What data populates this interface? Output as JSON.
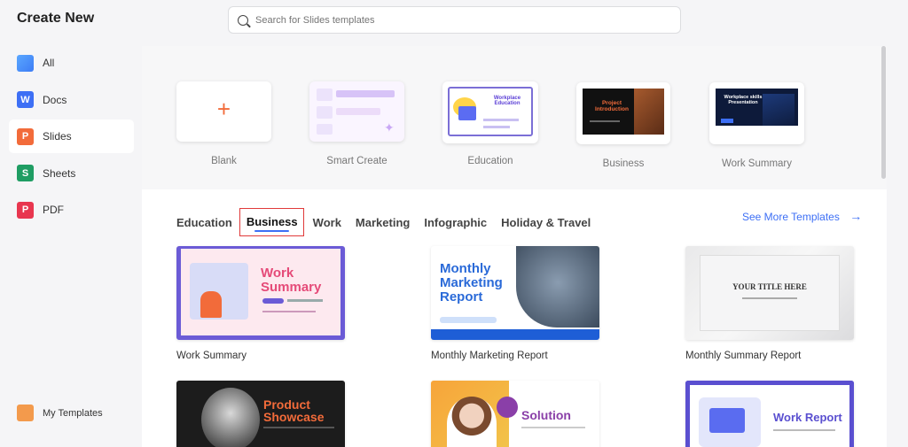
{
  "app": {
    "title": "Create New"
  },
  "search": {
    "placeholder": "Search for Slides templates"
  },
  "sidebar": {
    "items": [
      {
        "label": "All",
        "icon": "layers-icon"
      },
      {
        "label": "Docs",
        "icon": "docs-icon",
        "glyph": "W"
      },
      {
        "label": "Slides",
        "icon": "slides-icon",
        "glyph": "P"
      },
      {
        "label": "Sheets",
        "icon": "sheets-icon",
        "glyph": "S"
      },
      {
        "label": "PDF",
        "icon": "pdf-icon",
        "glyph": "P"
      }
    ],
    "my_templates": "My Templates"
  },
  "create_row": [
    {
      "label": "Blank"
    },
    {
      "label": "Smart Create"
    },
    {
      "label": "Education"
    },
    {
      "label": "Business"
    },
    {
      "label": "Work Summary"
    }
  ],
  "thumb_text": {
    "education_title": "Workplace Education",
    "project_intro": "Project Introduction",
    "workplace_skills": "Workplace skills Presentation",
    "work_summary_1": "Work",
    "work_summary_2": "Summary",
    "monthly_marketing": "Monthly Marketing Report",
    "your_title": "YOUR TITLE HERE",
    "product_showcase": "Product Showcase",
    "solution": "Solution",
    "work_report": "Work Report"
  },
  "tabs": {
    "items": [
      "Education",
      "Business",
      "Work",
      "Marketing",
      "Infographic",
      "Holiday & Travel"
    ],
    "active": "Business",
    "see_more": "See More Templates"
  },
  "templates": [
    {
      "name": "Work Summary"
    },
    {
      "name": "Monthly Marketing Report"
    },
    {
      "name": "Monthly Summary Report"
    },
    {
      "name": ""
    },
    {
      "name": ""
    },
    {
      "name": ""
    }
  ],
  "colors": {
    "accent": "#3d6ff5",
    "brand_orange": "#f26b3a",
    "tab_highlight": "#e03a3a"
  }
}
